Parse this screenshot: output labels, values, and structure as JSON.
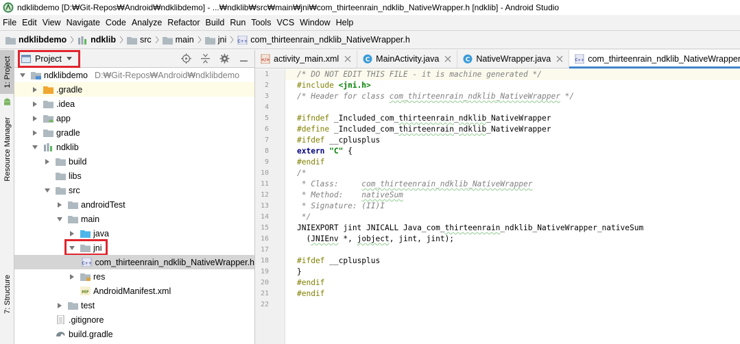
{
  "window": {
    "title": "ndklibdemo [D:₩Git-Repos₩Android₩ndklibdemo] - ...₩ndklib₩src₩main₩jni₩com_thirteenrain_ndklib_NativeWrapper.h [ndklib] - Android Studio"
  },
  "menu": [
    "File",
    "Edit",
    "View",
    "Navigate",
    "Code",
    "Analyze",
    "Refactor",
    "Build",
    "Run",
    "Tools",
    "VCS",
    "Window",
    "Help"
  ],
  "breadcrumb": [
    "ndklibdemo",
    "ndklib",
    "src",
    "main",
    "jni",
    "com_thirteenrain_ndklib_NativeWrapper.h"
  ],
  "left_strip": {
    "project_tab": "1: Project",
    "resource_manager_tab": "Resource Manager",
    "structure_tab": "7: Structure"
  },
  "project_panel": {
    "view_selector": "Project"
  },
  "tree": [
    {
      "label": "ndklibdemo",
      "path": "D:₩Git-Repos₩Android₩ndklibdemo"
    },
    {
      "label": ".gradle"
    },
    {
      "label": ".idea"
    },
    {
      "label": "app"
    },
    {
      "label": "gradle"
    },
    {
      "label": "ndklib"
    },
    {
      "label": "build"
    },
    {
      "label": "libs"
    },
    {
      "label": "src"
    },
    {
      "label": "androidTest"
    },
    {
      "label": "main"
    },
    {
      "label": "java"
    },
    {
      "label": "jni"
    },
    {
      "label": "com_thirteenrain_ndklib_NativeWrapper.h"
    },
    {
      "label": "res"
    },
    {
      "label": "AndroidManifest.xml"
    },
    {
      "label": "test"
    },
    {
      "label": ".gitignore"
    },
    {
      "label": "build.gradle"
    }
  ],
  "tabs": [
    {
      "label": "activity_main.xml"
    },
    {
      "label": "MainActivity.java"
    },
    {
      "label": "NativeWrapper.java"
    },
    {
      "label": "com_thirteenrain_ndklib_NativeWrapper.h"
    }
  ],
  "code": {
    "line_numbers": [
      "1",
      "2",
      "3",
      "4",
      "5",
      "6",
      "7",
      "8",
      "9",
      "10",
      "11",
      "12",
      "13",
      "14",
      "15",
      "16",
      "17",
      "18",
      "19",
      "20",
      "21",
      "22"
    ],
    "lines": [
      "/* DO NOT EDIT THIS FILE - it is machine generated */",
      "#include <jni.h>",
      "/* Header for class com_thirteenrain_ndklib_NativeWrapper */",
      "",
      "#ifndef _Included_com_thirteenrain_ndklib_NativeWrapper",
      "#define _Included_com_thirteenrain_ndklib_NativeWrapper",
      "#ifdef __cplusplus",
      "extern \"C\" {",
      "#endif",
      "/*",
      " * Class:     com_thirteenrain_ndklib_NativeWrapper",
      " * Method:    nativeSum",
      " * Signature: (II)I",
      " */",
      "JNIEXPORT jint JNICALL Java_com_thirteenrain_ndklib_NativeWrapper_nativeSum",
      "  (JNIEnv *, jobject, jint, jint);",
      "",
      "#ifdef __cplusplus",
      "}",
      "#endif",
      "#endif",
      ""
    ]
  },
  "colors": {
    "highlight_box": "#e0252d",
    "tab_underline": "#4083c9",
    "folder_orange": "#f0a732",
    "folder_gray": "#aeb9c0",
    "folder_blue": "#4db6e8"
  }
}
